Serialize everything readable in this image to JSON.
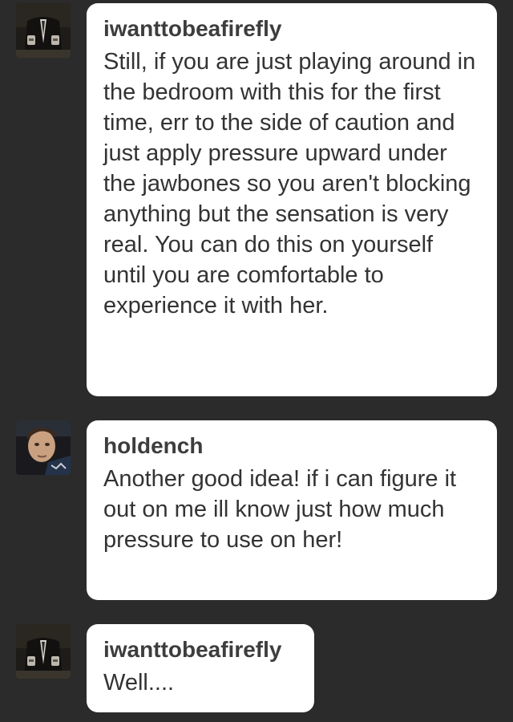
{
  "messages": [
    {
      "username": "iwanttobeafirefly",
      "avatar_icon": "user-avatar-suit",
      "text": "Still, if you are just playing around in the bedroom with this for the first time, err to the side of caution and just apply pressure upward under the jawbones so you aren't blocking anything but the sensation is very real. You can do this on yourself until you are comfortable to experience it with her."
    },
    {
      "username": "holdench",
      "avatar_icon": "user-avatar-face",
      "text": "Another good idea! if i can figure it out on me ill know just how much pressure to use on her!"
    },
    {
      "username": "iwanttobeafirefly",
      "avatar_icon": "user-avatar-suit",
      "text": "Well...."
    }
  ],
  "colors": {
    "background": "#2b2b2b",
    "bubble": "#ffffff",
    "username": "#3d3d3d",
    "text": "#333333"
  }
}
